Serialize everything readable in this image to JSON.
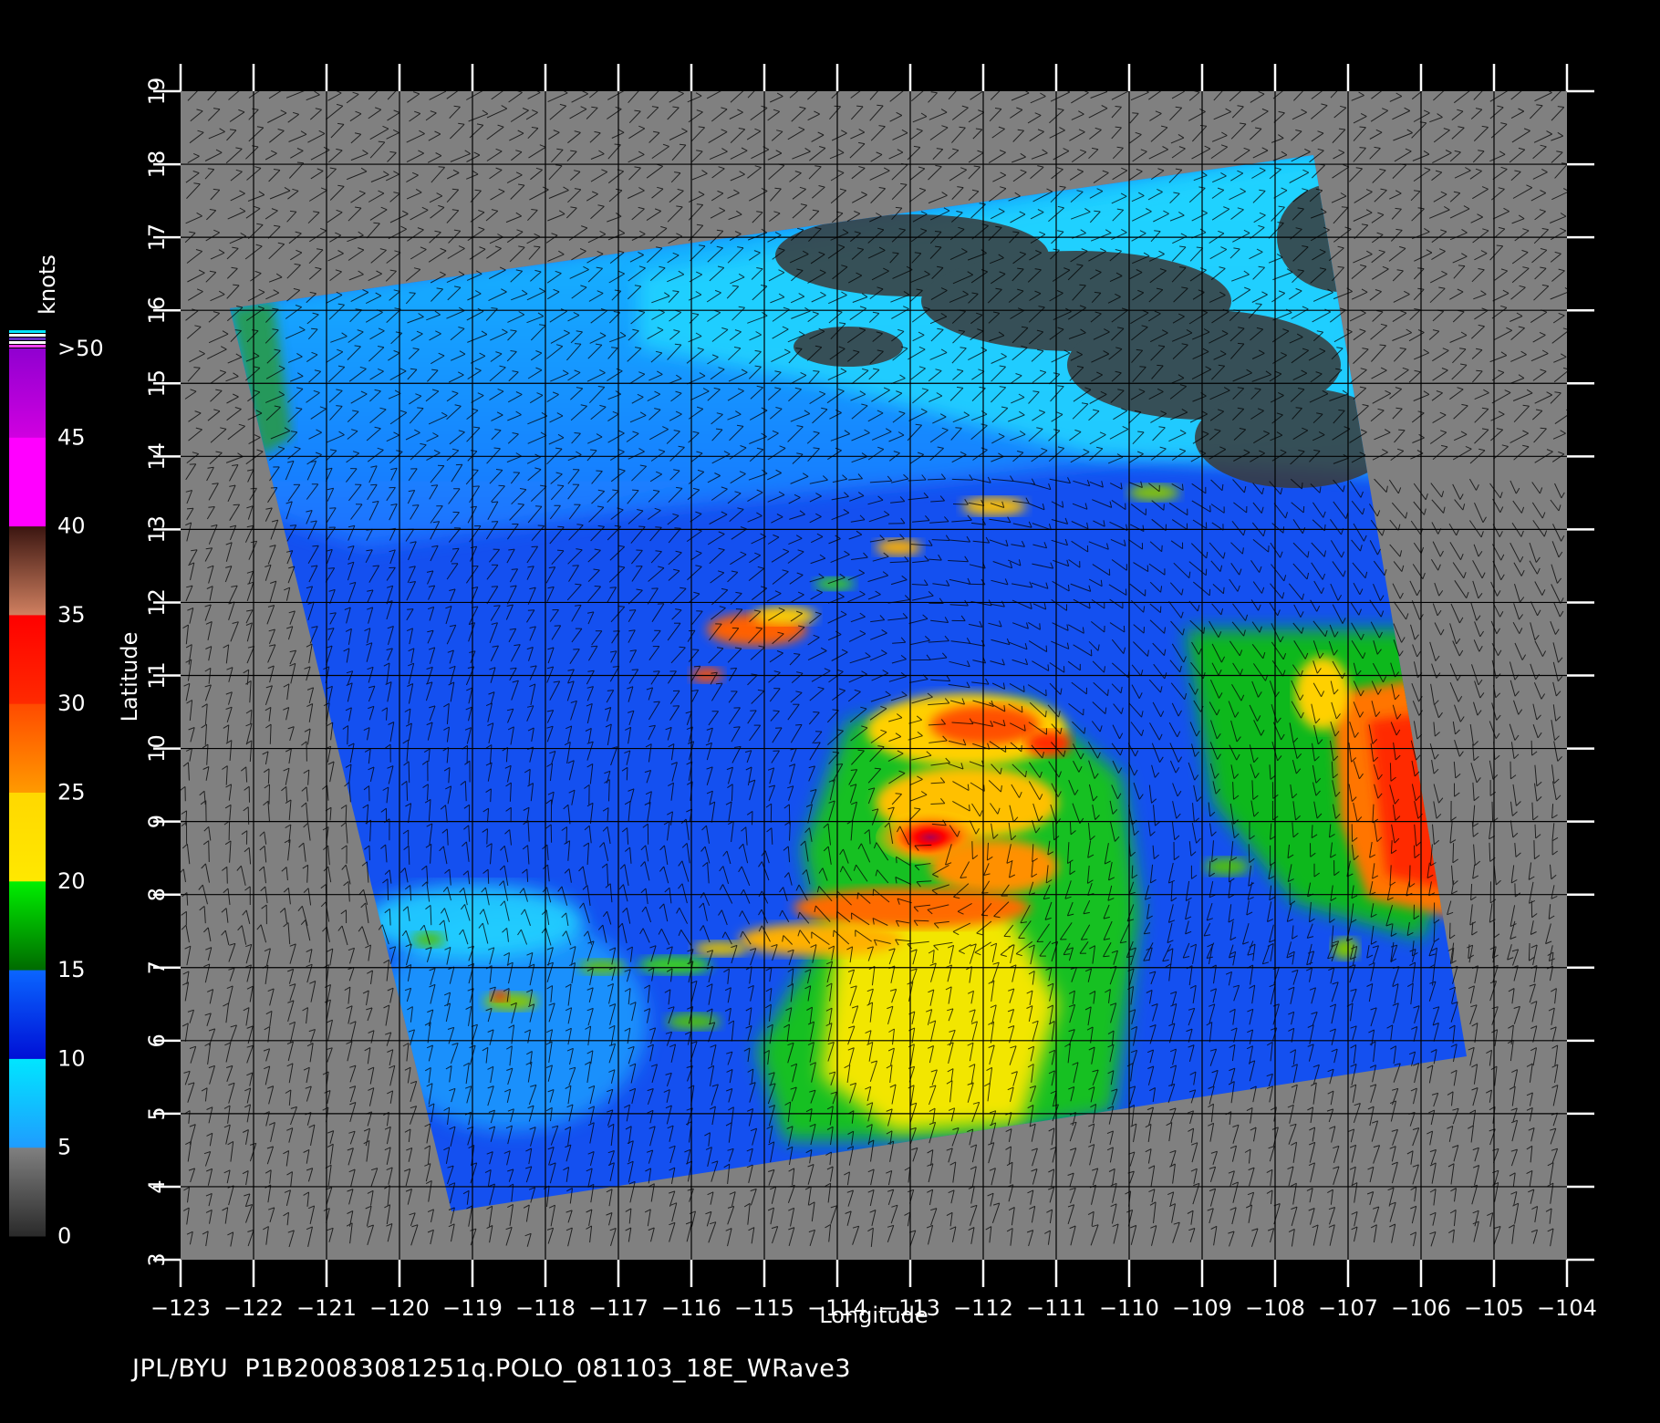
{
  "map": {
    "longitude_label": "Longitude",
    "latitude_label": "Latitude",
    "lon_ticks": [
      "−123",
      "−122",
      "−121",
      "−120",
      "−119",
      "−118",
      "−117",
      "−116",
      "−115",
      "−114",
      "−113",
      "−112",
      "−111",
      "−110",
      "−109",
      "−108",
      "−107",
      "−106",
      "−105",
      "−104"
    ],
    "lat_ticks": [
      "3",
      "4",
      "5",
      "6",
      "7",
      "8",
      "9",
      "10",
      "11",
      "12",
      "13",
      "14",
      "15",
      "16",
      "17",
      "18",
      "19"
    ],
    "background_color": "#808080",
    "grid_color": "#000000"
  },
  "colorbar": {
    "unit": "knots",
    "labels": [
      "0",
      "5",
      "10",
      "15",
      "20",
      "25",
      "30",
      "35",
      "40",
      "45",
      ">50"
    ],
    "stops": [
      {
        "from": 0,
        "to": 5,
        "top": "#808080",
        "bottom": "#2a2a2a"
      },
      {
        "from": 5,
        "to": 10,
        "top": "#00e6ff",
        "bottom": "#1f9cff"
      },
      {
        "from": 10,
        "to": 15,
        "top": "#0a66ff",
        "bottom": "#0010d6"
      },
      {
        "from": 15,
        "to": 20,
        "top": "#00f000",
        "bottom": "#006a00"
      },
      {
        "from": 20,
        "to": 25,
        "top": "#ffd800",
        "bottom": "#ffe800"
      },
      {
        "from": 25,
        "to": 30,
        "top": "#ff4a00",
        "bottom": "#ff9a00"
      },
      {
        "from": 30,
        "to": 35,
        "top": "#ff0000",
        "bottom": "#ff2a00"
      },
      {
        "from": 35,
        "to": 40,
        "top": "#3a1510",
        "bottom": "#d08060"
      },
      {
        "from": 40,
        "to": 45,
        "top": "#ff00ff",
        "bottom": "#ff00ff"
      },
      {
        "from": 45,
        "to": 50,
        "top": "#9000d0",
        "bottom": "#d000e0"
      }
    ]
  },
  "footer": {
    "text": "JPL/BYU  P1B20083081251q.POLO_081103_18E_WRave3"
  }
}
